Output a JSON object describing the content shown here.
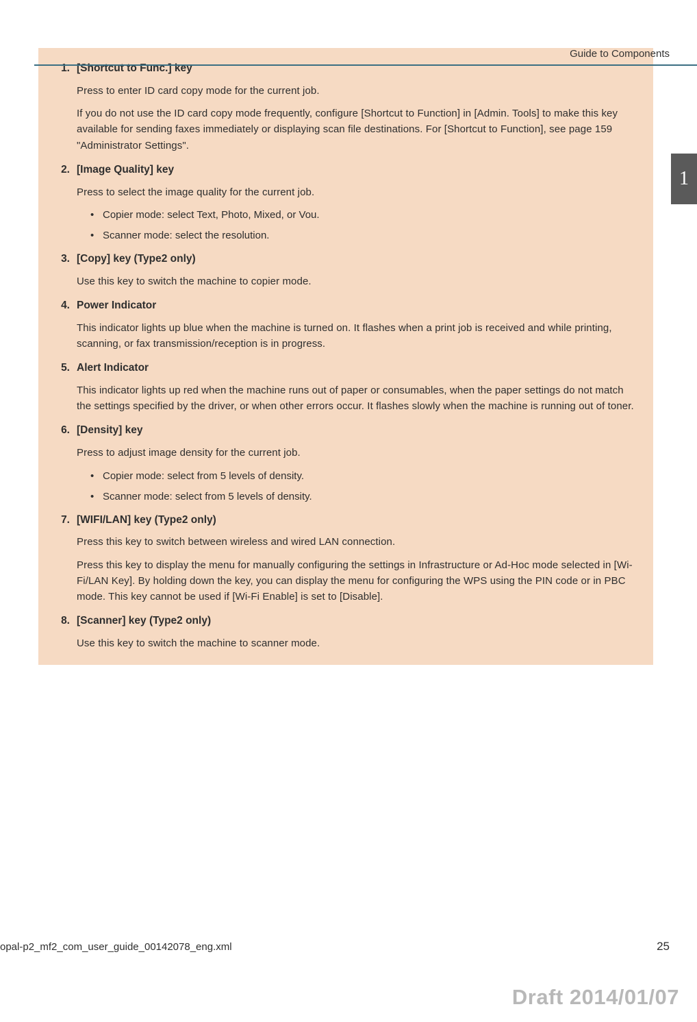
{
  "header": {
    "section_title": "Guide to Components"
  },
  "tab": {
    "label": "1"
  },
  "items": [
    {
      "num": "1.",
      "title": "[Shortcut to Func.] key",
      "paras": [
        "Press to enter ID card copy mode for the current job.",
        "If you do not use the ID card copy mode frequently, configure [Shortcut to Function] in [Admin. Tools] to make this key available for sending faxes immediately or displaying scan file destinations. For [Shortcut to Function], see page 159 \"Administrator Settings\"."
      ],
      "bullets": []
    },
    {
      "num": "2.",
      "title": "[Image Quality] key",
      "paras": [
        "Press to select the image quality for the current job."
      ],
      "bullets": [
        "Copier mode: select Text, Photo, Mixed, or Vou.",
        "Scanner mode: select the resolution."
      ]
    },
    {
      "num": "3.",
      "title": "[Copy] key (Type2 only)",
      "paras": [
        "Use this key to switch the machine to copier mode."
      ],
      "bullets": []
    },
    {
      "num": "4.",
      "title": "Power Indicator",
      "paras": [
        "This indicator lights up blue when the machine is turned on. It flashes when a print job is received and while printing, scanning, or fax transmission/reception is in progress."
      ],
      "bullets": []
    },
    {
      "num": "5.",
      "title": "Alert Indicator",
      "paras": [
        "This indicator lights up red when the machine runs out of paper or consumables, when the paper settings do not match the settings specified by the driver, or when other errors occur. It flashes slowly when the machine is running out of toner."
      ],
      "bullets": []
    },
    {
      "num": "6.",
      "title": "[Density] key",
      "paras": [
        "Press to adjust image density for the current job."
      ],
      "bullets": [
        "Copier mode: select from 5 levels of density.",
        "Scanner mode: select from 5 levels of density."
      ]
    },
    {
      "num": "7.",
      "title": "[WIFI/LAN] key (Type2 only)",
      "paras": [
        "Press this key to switch between wireless and wired LAN connection.",
        "Press this key to display the menu for manually configuring the settings in Infrastructure or Ad-Hoc mode selected in [Wi-Fi/LAN Key]. By holding down the key, you can display the menu for configuring the WPS using the PIN code or in PBC mode. This key cannot be used if [Wi-Fi Enable] is set to [Disable]."
      ],
      "bullets": []
    },
    {
      "num": "8.",
      "title": "[Scanner] key (Type2 only)",
      "paras": [
        "Use this key to switch the machine to scanner mode."
      ],
      "bullets": []
    }
  ],
  "footer": {
    "filename": "opal-p2_mf2_com_user_guide_00142078_eng.xml",
    "page_number": "25",
    "draft_stamp": "Draft 2014/01/07"
  }
}
